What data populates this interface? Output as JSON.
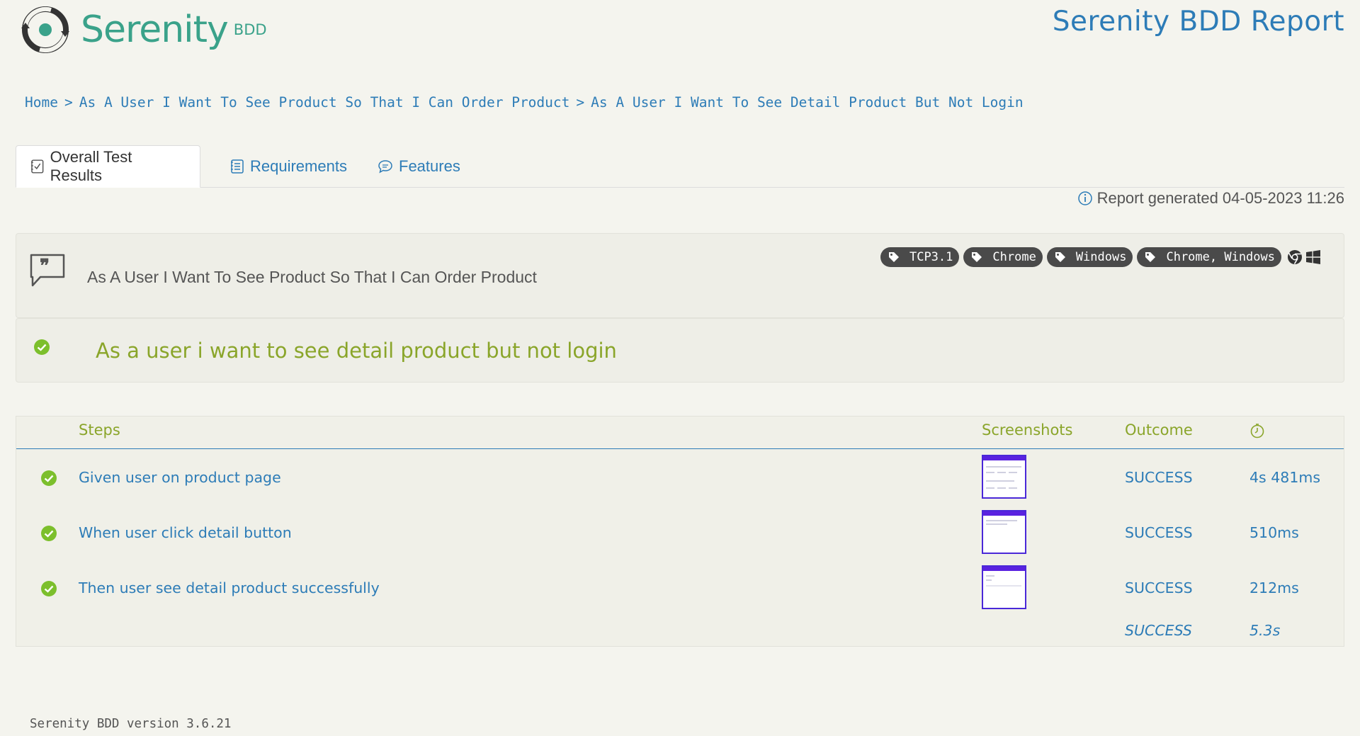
{
  "header": {
    "logo_text": "Serenity",
    "logo_suffix": "BDD",
    "report_title": "Serenity BDD Report"
  },
  "breadcrumb": {
    "items": [
      "Home",
      "As A User I Want To See Product So That I Can Order Product",
      "As A User I Want To See Detail Product But Not Login"
    ],
    "separator": ">"
  },
  "tabs": [
    {
      "label": "Overall Test Results",
      "icon": "checklist-icon",
      "active": true
    },
    {
      "label": "Requirements",
      "icon": "list-icon",
      "active": false
    },
    {
      "label": "Features",
      "icon": "comments-icon",
      "active": false
    }
  ],
  "report_generated": "Report generated 04-05-2023 11:26",
  "feature": {
    "title": "As A User I Want To See Product So That I Can Order Product",
    "tags": [
      "TCP3.1",
      "Chrome",
      "Windows",
      "Chrome, Windows"
    ],
    "platform_icons": [
      "chrome-icon",
      "windows-icon"
    ]
  },
  "scenario": {
    "title": "As a user i want to see detail product but not login",
    "status": "success"
  },
  "steps_table": {
    "headers": {
      "steps": "Steps",
      "screenshots": "Screenshots",
      "outcome": "Outcome",
      "duration_icon": "clock-icon"
    },
    "rows": [
      {
        "description": "Given user on product page",
        "outcome": "SUCCESS",
        "duration": "4s 481ms"
      },
      {
        "description": "When user click detail button",
        "outcome": "SUCCESS",
        "duration": "510ms"
      },
      {
        "description": "Then user see detail product successfully",
        "outcome": "SUCCESS",
        "duration": "212ms"
      }
    ],
    "total": {
      "outcome": "SUCCESS",
      "duration": "5.3s"
    }
  },
  "footer": {
    "version": "Serenity BDD version 3.6.21"
  },
  "colors": {
    "link": "#2d7cb7",
    "success": "#8aa52a",
    "check": "#7cbf2c",
    "brand": "#3aa28a",
    "tag_bg": "#4a4a4a"
  }
}
